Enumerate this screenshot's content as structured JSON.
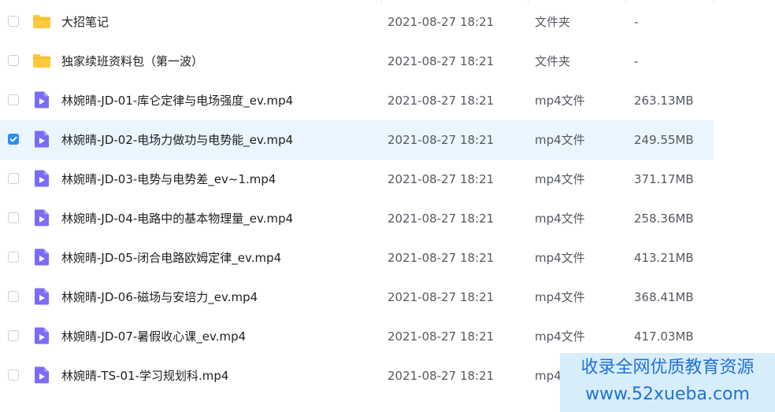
{
  "colors": {
    "folder": "#ffc83d",
    "video_icon": "#7b6cf6",
    "selected_row": "#eaf5fd",
    "checkbox_checked": "#2b8ef5",
    "watermark_text": "#1e73d8"
  },
  "files": [
    {
      "name": "大招笔记",
      "date": "2021-08-27 18:21",
      "type": "文件夹",
      "size": "-",
      "icon": "folder-icon",
      "selected": false
    },
    {
      "name": "独家续班资料包（第一波）",
      "date": "2021-08-27 18:21",
      "type": "文件夹",
      "size": "-",
      "icon": "folder-icon",
      "selected": false
    },
    {
      "name": "林婉晴-JD-01-库仑定律与电场强度_ev.mp4",
      "date": "2021-08-27 18:21",
      "type": "mp4文件",
      "size": "263.13MB",
      "icon": "video-file-icon",
      "selected": false
    },
    {
      "name": "林婉晴-JD-02-电场力做功与电势能_ev.mp4",
      "date": "2021-08-27 18:21",
      "type": "mp4文件",
      "size": "249.55MB",
      "icon": "video-file-icon",
      "selected": true
    },
    {
      "name": "林婉晴-JD-03-电势与电势差_ev~1.mp4",
      "date": "2021-08-27 18:21",
      "type": "mp4文件",
      "size": "371.17MB",
      "icon": "video-file-icon",
      "selected": false
    },
    {
      "name": "林婉晴-JD-04-电路中的基本物理量_ev.mp4",
      "date": "2021-08-27 18:21",
      "type": "mp4文件",
      "size": "258.36MB",
      "icon": "video-file-icon",
      "selected": false
    },
    {
      "name": "林婉晴-JD-05-闭合电路欧姆定律_ev.mp4",
      "date": "2021-08-27 18:21",
      "type": "mp4文件",
      "size": "413.21MB",
      "icon": "video-file-icon",
      "selected": false
    },
    {
      "name": "林婉晴-JD-06-磁场与安培力_ev.mp4",
      "date": "2021-08-27 18:21",
      "type": "mp4文件",
      "size": "368.41MB",
      "icon": "video-file-icon",
      "selected": false
    },
    {
      "name": "林婉晴-JD-07-暑假收心课_ev.mp4",
      "date": "2021-08-27 18:21",
      "type": "mp4文件",
      "size": "417.03MB",
      "icon": "video-file-icon",
      "selected": false
    },
    {
      "name": "林婉晴-TS-01-学习规划科.mp4",
      "date": "2021-08-27 18:21",
      "type": "mp4",
      "size": "",
      "icon": "video-file-icon",
      "selected": false
    }
  ],
  "watermark": {
    "line1": "收录全网优质教育资源",
    "line2": "www.52xueba.com"
  }
}
